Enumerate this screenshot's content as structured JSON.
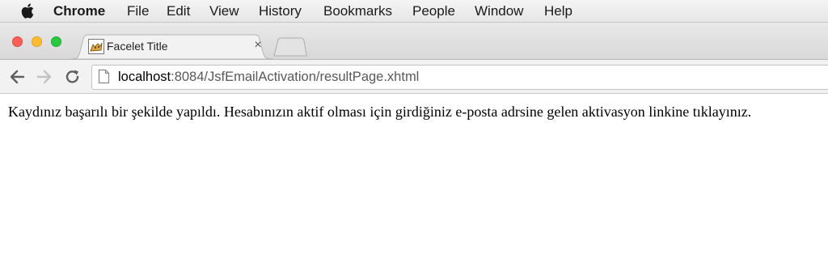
{
  "menubar": {
    "app_name": "Chrome",
    "items": [
      "File",
      "Edit",
      "View",
      "History",
      "Bookmarks",
      "People",
      "Window",
      "Help"
    ]
  },
  "tab": {
    "title": "Facelet Title",
    "close_glyph": "×",
    "favicon": "tomcat-cat-icon"
  },
  "toolbar": {
    "url_host": "localhost",
    "url_rest": ":8084/JsfEmailActivation/resultPage.xhtml"
  },
  "page": {
    "message": "Kaydınız başarılı bir şekilde yapıldı. Hesabınızın aktif olması için girdiğiniz e-posta adrsine gelen aktivasyon linkine tıklayınız."
  },
  "colors": {
    "close_red": "#fc5f57",
    "minimize_yellow": "#fdbc2e",
    "zoom_green": "#29c840"
  }
}
